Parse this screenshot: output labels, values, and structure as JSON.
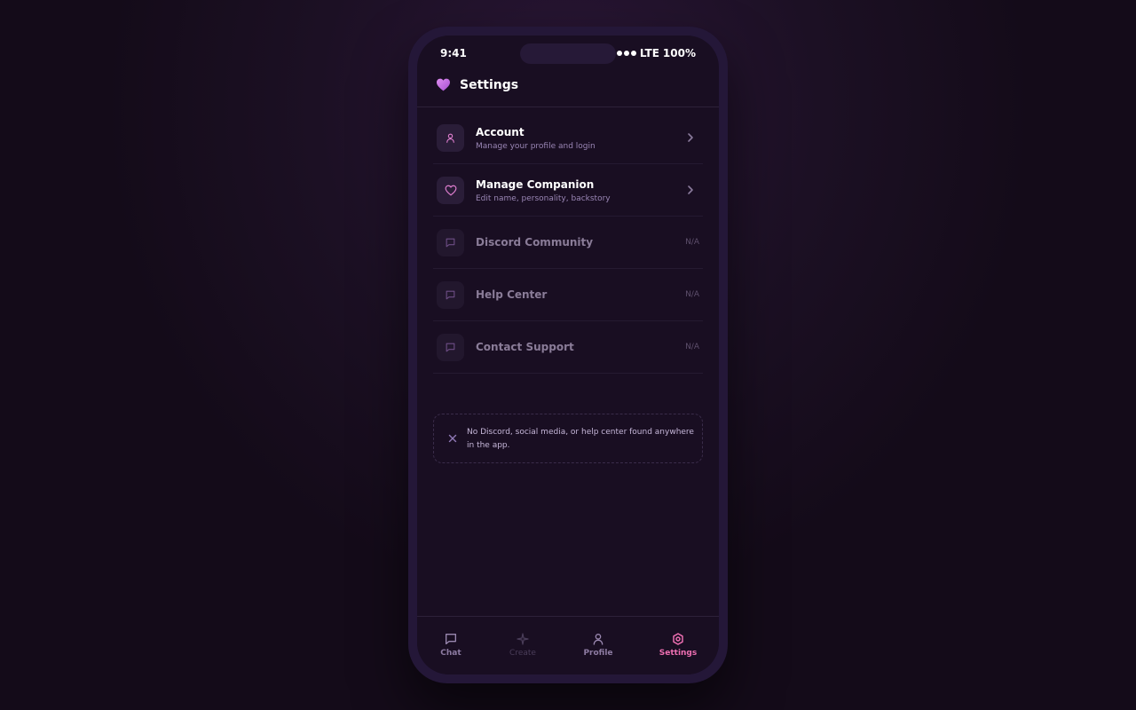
{
  "status_bar": {
    "time": "9:41",
    "network": "LTE",
    "battery": "100%"
  },
  "header": {
    "title": "Settings",
    "icon": "purple-heart-icon"
  },
  "settings": [
    {
      "title": "Account",
      "subtitle": "Manage your profile and login",
      "icon": "user-icon"
    },
    {
      "title": "Manage Companion",
      "subtitle": "Edit name, personality, backstory",
      "icon": "heart-icon"
    },
    {
      "title": "Discord Community",
      "status": "N/A",
      "icon": "chat-bubble-icon"
    },
    {
      "title": "Help Center",
      "status": "N/A",
      "icon": "chat-bubble-icon"
    },
    {
      "title": "Contact Support",
      "status": "N/A",
      "icon": "chat-bubble-icon"
    }
  ],
  "notice": {
    "text": "No Discord, social media, or help center found anywhere in the app.",
    "icon": "close-x-icon"
  },
  "tabbar": {
    "items": [
      {
        "label": "Chat",
        "icon": "chat-bubble-icon"
      },
      {
        "label": "Create",
        "icon": "sparkle-icon"
      },
      {
        "label": "Profile",
        "icon": "user-icon"
      },
      {
        "label": "Settings",
        "icon": "gear-icon"
      }
    ],
    "active": "Settings"
  },
  "colors": {
    "accent_pink": "#ee6fb2",
    "accent_purple": "#c07be0",
    "background": "#190e22",
    "phone_frame": "#241738"
  }
}
